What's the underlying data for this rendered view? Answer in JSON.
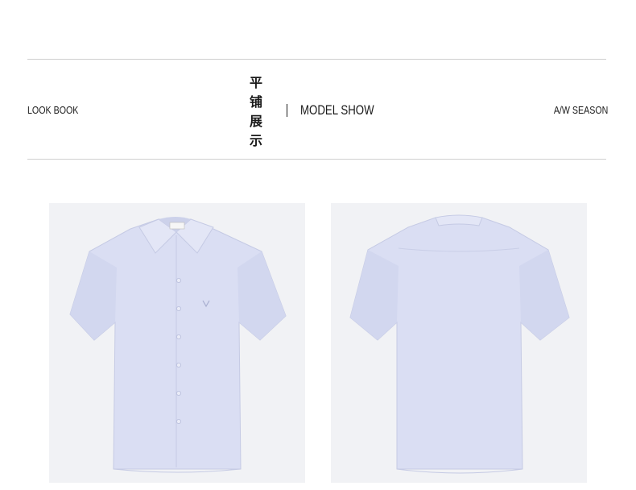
{
  "header": {
    "left_label": "LOOK BOOK",
    "center_cn": "平铺展示",
    "center_en": "MODEL SHOW",
    "right_label": "A/W SEASON"
  },
  "products": [
    {
      "view": "front",
      "icon": "shirt-front-icon",
      "label_text": ""
    },
    {
      "view": "back",
      "icon": "shirt-back-icon"
    }
  ],
  "colors": {
    "shirt": "#d9ddf2",
    "shirt_shadow": "#c8cde6",
    "panel_bg": "#f1f2f5",
    "rule": "#cfcfcf",
    "text": "#1a1a1a"
  }
}
